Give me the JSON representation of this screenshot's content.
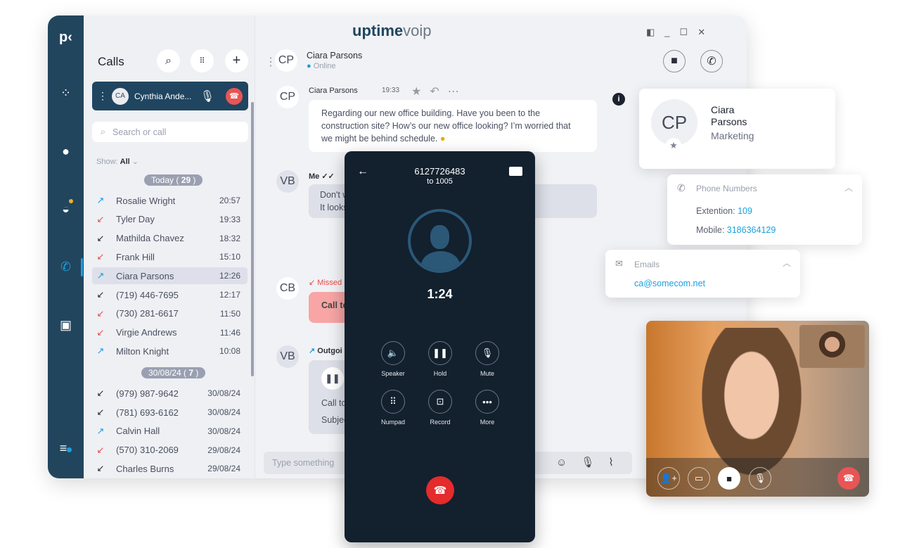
{
  "app": {
    "brand": "uptime",
    "brand2": "voip",
    "logo_mark": "p"
  },
  "calls_panel": {
    "title": "Calls",
    "active_call": {
      "initials": "CA",
      "name": "Cynthia Ande..."
    },
    "search_placeholder": "Search or call",
    "show_label": "Show:",
    "show_value": "All",
    "groups": [
      {
        "label": "Today",
        "count": "29",
        "items": [
          {
            "name": "Rosalie Wright",
            "time": "20:57",
            "type": "outgoing"
          },
          {
            "name": "Tyler Day",
            "time": "19:33",
            "type": "missed"
          },
          {
            "name": "Mathilda Chavez",
            "time": "18:32",
            "type": "incoming"
          },
          {
            "name": "Frank Hill",
            "time": "15:10",
            "type": "missed"
          },
          {
            "name": "Ciara Parsons",
            "time": "12:26",
            "type": "outgoing",
            "selected": true
          },
          {
            "name": "(719) 446-7695",
            "time": "12:17",
            "type": "incoming"
          },
          {
            "name": "(730) 281-6617",
            "time": "11:50",
            "type": "missed"
          },
          {
            "name": "Virgie Andrews",
            "time": "11:46",
            "type": "missed"
          },
          {
            "name": "Milton Knight",
            "time": "10:08",
            "type": "outgoing"
          }
        ]
      },
      {
        "label": "30/08/24",
        "count": "7",
        "items": [
          {
            "name": "(979) 987-9642",
            "time": "30/08/24",
            "type": "incoming"
          },
          {
            "name": "(781) 693-6162",
            "time": "30/08/24",
            "type": "incoming"
          },
          {
            "name": "Calvin Hall",
            "time": "30/08/24",
            "type": "outgoing"
          },
          {
            "name": "(570) 310-2069",
            "time": "29/08/24",
            "type": "missed"
          },
          {
            "name": "Charles Burns",
            "time": "29/08/24",
            "type": "incoming"
          }
        ]
      }
    ]
  },
  "chat": {
    "contact": {
      "initials": "CP",
      "name": "Ciara Parsons",
      "status": "Online"
    },
    "messages": [
      {
        "initials": "CP",
        "author": "Ciara Parsons",
        "time": "19:33",
        "text": "Regarding our new office building. Have you been to the construction site? How’s our new office looking? I’m worried that we might be behind schedule."
      },
      {
        "initials": "VB",
        "author": "Me",
        "line1": "Don't w",
        "line2": "It looks"
      },
      {
        "initials": "CB",
        "label": "Missed",
        "text": "Call to"
      },
      {
        "initials": "VB",
        "label": "Outgoi",
        "line1": "Call to",
        "line2": "Subjec"
      }
    ],
    "input_placeholder": "Type something"
  },
  "call": {
    "number": "6127726483",
    "to": "to 1005",
    "duration": "1:24",
    "buttons": [
      {
        "label": "Speaker",
        "icon": "speaker-icon"
      },
      {
        "label": "Hold",
        "icon": "pause-icon"
      },
      {
        "label": "Mute",
        "icon": "mic-off-icon"
      },
      {
        "label": "Numpad",
        "icon": "numpad-icon"
      },
      {
        "label": "Record",
        "icon": "record-icon"
      },
      {
        "label": "More",
        "icon": "more-icon"
      }
    ]
  },
  "contact": {
    "initials": "CP",
    "first": "Ciara",
    "last": "Parsons",
    "department": "Marketing",
    "phones_title": "Phone Numbers",
    "ext_label": "Extention:",
    "ext": "109",
    "mobile_label": "Mobile:",
    "mobile": "3186364129",
    "emails_title": "Emails",
    "email": "ca@somecom.net"
  },
  "colors": {
    "rail": "#22455e",
    "accent": "#1aa0e0",
    "missed": "#e84a4a",
    "hangup": "#e85555",
    "phone_bg": "#13202e"
  }
}
